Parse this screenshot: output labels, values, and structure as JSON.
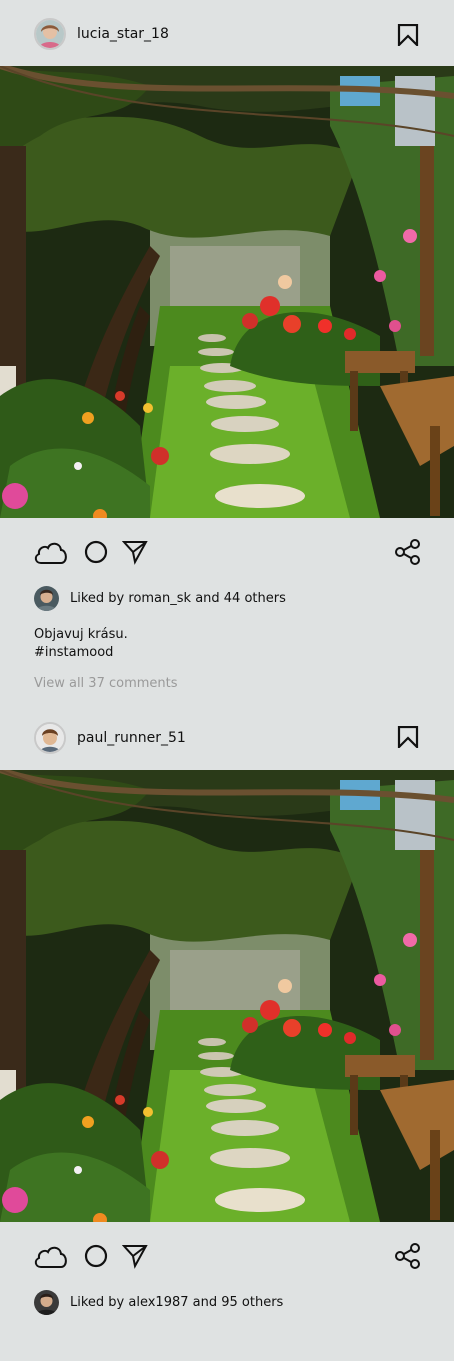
{
  "posts": [
    {
      "username": "lucia_star_18",
      "liked_by_text": "Liked by roman_sk and 44 others",
      "caption_line1": "Objavuj krásu.",
      "caption_line2": "#instamood",
      "view_comments": "View all 37 comments"
    },
    {
      "username": "paul_runner_51",
      "liked_by_text": "Liked by alex1987 and 95 others"
    }
  ],
  "icons": {
    "bookmark": "bookmark-icon",
    "like": "cloud-icon",
    "comment": "circle-icon",
    "send": "send-icon",
    "share": "share-icon"
  },
  "colors": {
    "background": "#dfe2e2",
    "text": "#111111",
    "muted": "#9a9a9a"
  }
}
